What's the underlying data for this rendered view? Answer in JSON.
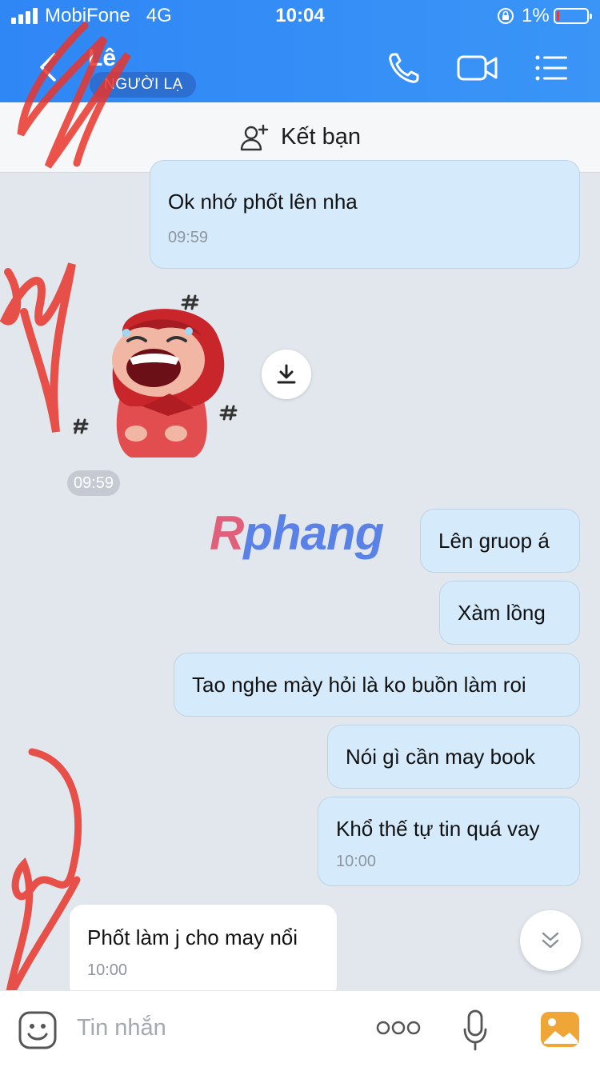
{
  "status_bar": {
    "carrier": "MobiFone",
    "network": "4G",
    "time": "10:04",
    "battery": "1%"
  },
  "header": {
    "contact_name": "Lê",
    "stranger_badge": "NGƯỜI LẠ"
  },
  "add_friend": {
    "label": "Kết bạn"
  },
  "messages": [
    {
      "dir": "out",
      "text": "Ok nhớ phốt lên nha",
      "time": "09:59"
    },
    {
      "dir": "in",
      "type": "sticker",
      "time": "09:59"
    },
    {
      "dir": "out",
      "text": "Lên gruop á"
    },
    {
      "dir": "out",
      "text": "Xàm lồng"
    },
    {
      "dir": "out",
      "text": "Tao nghe mày hỏi là ko buồn làm roi"
    },
    {
      "dir": "out",
      "text": "Nói gì cần may book"
    },
    {
      "dir": "out",
      "text": "Khổ thế tự tin quá vay",
      "time": "10:00"
    },
    {
      "dir": "in",
      "text": "Phốt làm j cho may nổi",
      "time": "10:00"
    }
  ],
  "watermark": {
    "part1": "R",
    "part2": "phang"
  },
  "input": {
    "placeholder": "Tin nhắn"
  },
  "colors": {
    "header_blue": "#2f86f5",
    "bubble_out": "#d5ebfc",
    "bubble_in": "#ffffff",
    "chat_bg": "#e2e7ee"
  }
}
